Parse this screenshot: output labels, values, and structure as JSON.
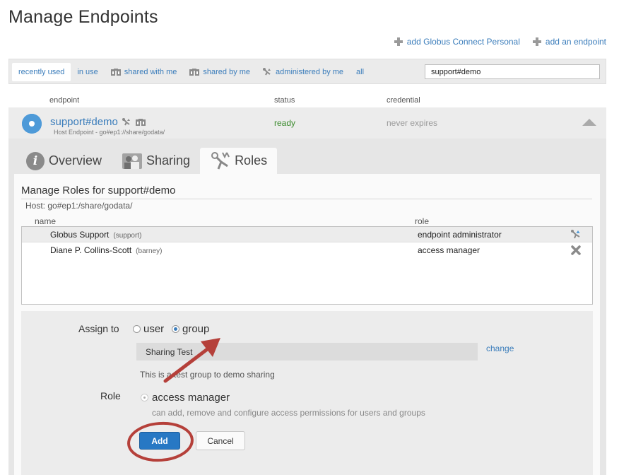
{
  "page": {
    "title": "Manage Endpoints"
  },
  "top_actions": {
    "add_gcp": "add Globus Connect Personal",
    "add_endpoint": "add an endpoint"
  },
  "filters": {
    "tabs": [
      {
        "label": "recently used",
        "active": true
      },
      {
        "label": "in use",
        "active": false
      },
      {
        "label": "shared with me",
        "active": false,
        "icon": "shared-icon"
      },
      {
        "label": "shared by me",
        "active": false,
        "icon": "shared-icon"
      },
      {
        "label": "administered by me",
        "active": false,
        "icon": "admin-icon"
      },
      {
        "label": "all",
        "active": false
      }
    ],
    "search_value": "support#demo"
  },
  "columns": {
    "endpoint": "endpoint",
    "status": "status",
    "credential": "credential"
  },
  "endpoint": {
    "name": "support#demo",
    "host": "Host Endpoint - go#ep1://share/godata/",
    "status": "ready",
    "credential": "never expires"
  },
  "tabs": [
    {
      "label": "Overview",
      "icon": "info-icon"
    },
    {
      "label": "Sharing",
      "icon": "sharing-icon"
    },
    {
      "label": "Roles",
      "icon": "roles-icon",
      "active": true
    }
  ],
  "roles": {
    "title": "Manage Roles for support#demo",
    "host": "Host: go#ep1:/share/godata/",
    "headers": {
      "name": "name",
      "role": "role"
    },
    "rows": [
      {
        "name": "Globus Support",
        "username": "(support)",
        "role": "endpoint administrator",
        "action_icon": "admin-icon"
      },
      {
        "name": "Diane P. Collins-Scott",
        "username": "(barney)",
        "role": "access manager",
        "action_icon": "delete-icon"
      }
    ]
  },
  "assign": {
    "assign_label": "Assign to",
    "option_user": "user",
    "option_group": "group",
    "selected": "group",
    "group_value": "Sharing Test",
    "change_label": "change",
    "group_description": "This is a test group to demo sharing",
    "role_label": "Role",
    "role_option": "access manager",
    "role_description": "can add, remove and configure access permissions for users and groups",
    "add_label": "Add",
    "cancel_label": "Cancel"
  },
  "colors": {
    "link": "#3b7dbb",
    "status_ready": "#3a8a2c",
    "add_button": "#2778c4",
    "annotation": "#b5403a"
  }
}
